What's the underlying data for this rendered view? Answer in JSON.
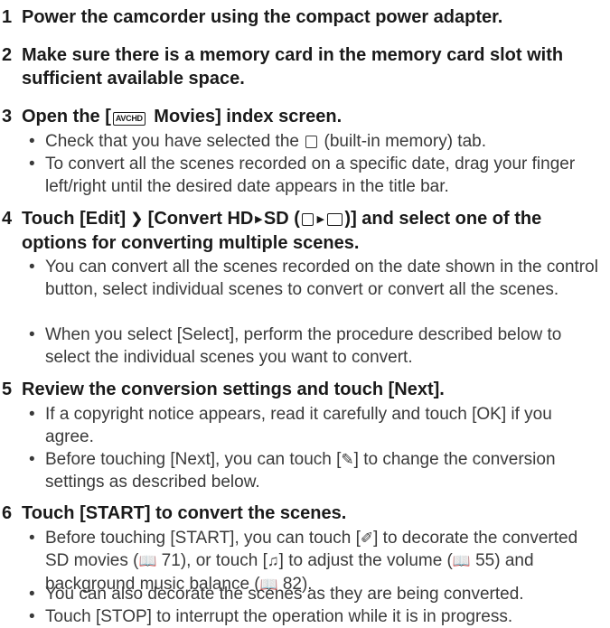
{
  "steps": [
    {
      "num": "1",
      "text": "Power the camcorder using the compact power adapter."
    },
    {
      "num": "2",
      "text": "Make sure there is a memory card in the memory card slot with sufficient available space."
    },
    {
      "num": "3",
      "t_a": "Open the [",
      "icon_avchd": "AVCHD",
      "t_b": " Movies] index screen.",
      "bullets": [
        {
          "t_a": "Check that you have selected the ",
          "t_b": " (built-in memory) tab."
        },
        {
          "text": "To convert all the scenes recorded on a specific date, drag your finger left/right until the desired date appears in the title bar."
        }
      ]
    },
    {
      "num": "4",
      "t_a": "Touch [Edit] ",
      "t_b": " [Convert HD",
      "arrow": "▸",
      "t_c": "SD (",
      "t_d": ")] and select one of the options for converting multiple scenes.",
      "bullets": [
        {
          "text": "You can convert all the scenes recorded on the date shown in the control button, select individual scenes to convert or convert all the scenes."
        },
        {
          "text": "When you select [Select], perform the procedure described below to select the individual scenes you want to convert."
        }
      ]
    },
    {
      "num": "5",
      "text": "Review the conversion settings and touch [Next].",
      "bullets": [
        {
          "text": "If a copyright notice appears, read it carefully and touch [OK] if you agree."
        },
        {
          "t_a": "Before touching [Next], you can touch [",
          "t_b": "] to change the conversion settings as described below."
        }
      ]
    },
    {
      "num": "6",
      "text": "Touch [START] to convert the scenes.",
      "bullets": [
        {
          "t_a": "Before touching [START], you can touch [",
          "t_b": "] to decorate the converted SD movies (",
          "p1": "71",
          "t_c": "), or touch [",
          "t_d": "] to adjust the volume (",
          "p2": "55",
          "t_e": ") and background music balance (",
          "p3": "82",
          "t_f": ")."
        },
        {
          "text": "You can also decorate the scenes as they are being converted."
        },
        {
          "text": "Touch [STOP] to interrupt the operation while it is in progress."
        }
      ]
    }
  ],
  "bullet_char": "•",
  "glyphs": {
    "play": "❯",
    "wrench": "✎",
    "decorate": "✐",
    "music": "♫",
    "book": "📖"
  }
}
